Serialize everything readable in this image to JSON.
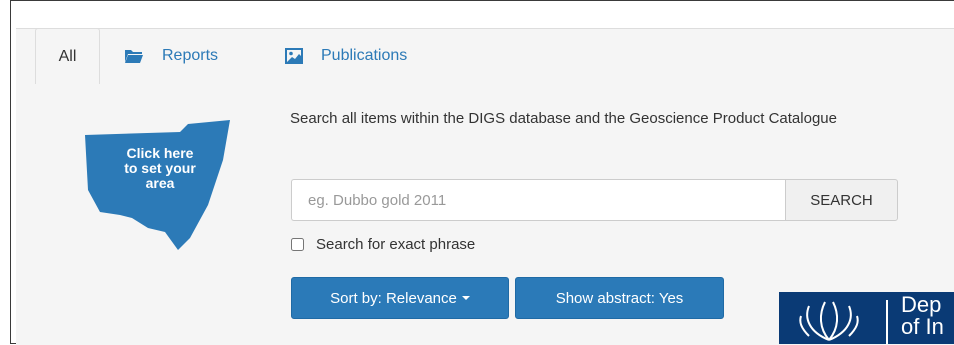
{
  "tabs": [
    {
      "label": "All",
      "icon": "none",
      "active": true
    },
    {
      "label": "Reports",
      "icon": "folder-icon",
      "active": false
    },
    {
      "label": "Publications",
      "icon": "image-icon",
      "active": false
    }
  ],
  "map_widget": {
    "text_lines": [
      "Click here",
      "to set your",
      "area"
    ],
    "color": "#2c7ab7"
  },
  "description": "Search all items within the DIGS database and the Geoscience Product Catalogue",
  "search": {
    "placeholder": "eg. Dubbo gold 2011",
    "value": "",
    "button_label": "SEARCH"
  },
  "exact_phrase": {
    "label": "Search for exact phrase",
    "checked": false
  },
  "sort_button": {
    "label": "Sort by: Relevance"
  },
  "abstract_button": {
    "label": "Show abstract: Yes"
  },
  "logo": {
    "text_lines": [
      "Dep",
      "of In"
    ],
    "color": "#0a3a75"
  },
  "colors": {
    "accent": "#2b7ab8",
    "panel_bg": "#f5f5f5"
  }
}
